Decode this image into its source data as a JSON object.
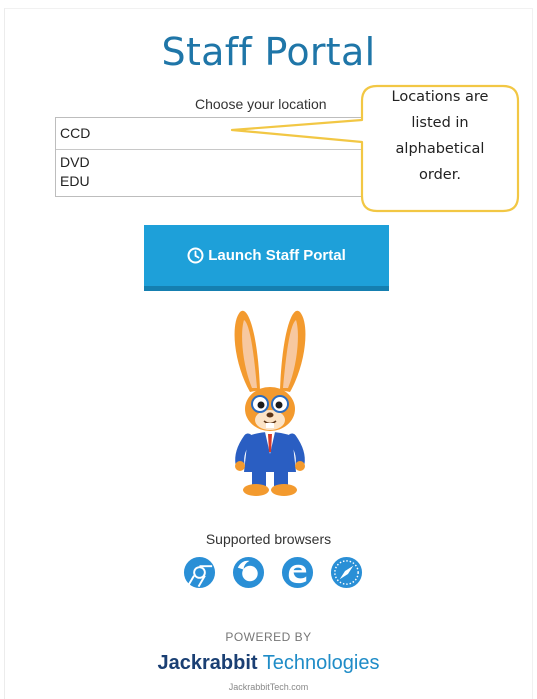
{
  "header": {
    "title": "Staff Portal"
  },
  "location": {
    "label": "Choose your location",
    "selected": "CCD",
    "options": [
      "DVD",
      "EDU"
    ]
  },
  "callout": {
    "lines": [
      "Locations are",
      "listed in",
      "alphabetical",
      "order."
    ]
  },
  "launch": {
    "label": "Launch Staff Portal"
  },
  "browsers": {
    "label": "Supported browsers",
    "icons": [
      "chrome-icon",
      "firefox-icon",
      "edge-icon",
      "safari-icon"
    ]
  },
  "footer": {
    "powered_by": "POWERED BY",
    "brand_name": "Jackrabbit",
    "brand_suffix": "Technologies",
    "site": "JackrabbitTech.com"
  },
  "colors": {
    "title": "#1f76a8",
    "button": "#1ea0d9",
    "callout_border": "#f2c744",
    "brand": "#1a3f73"
  }
}
